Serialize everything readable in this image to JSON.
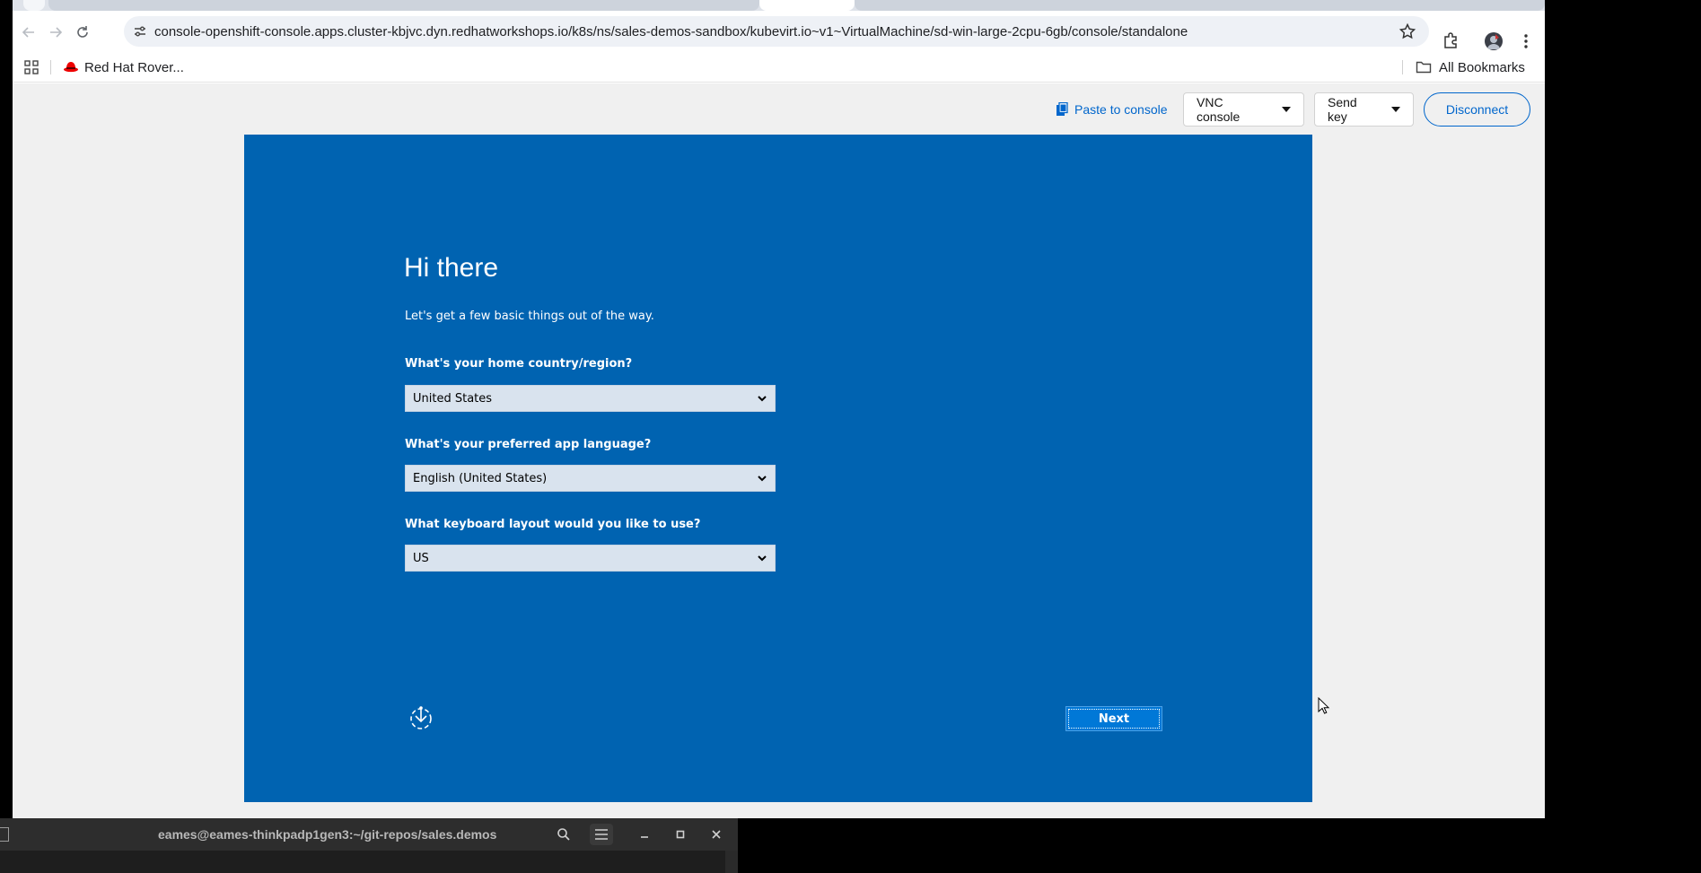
{
  "browser": {
    "url": "console-openshift-console.apps.cluster-kbjvc.dyn.redhatworkshops.io/k8s/ns/sales-demos-sandbox/kubevirt.io~v1~VirtualMachine/sd-win-large-2cpu-6gb/console/standalone",
    "icons": [
      "back-icon",
      "forward-icon",
      "reload-icon",
      "site-info-icon",
      "star-icon",
      "extensions-icon",
      "profile-avatar",
      "menu-icon"
    ]
  },
  "bookmarks": {
    "items": [
      {
        "label": "Red Hat Rover..."
      }
    ],
    "all_bookmarks_label": "All Bookmarks"
  },
  "console_toolbar": {
    "paste_label": "Paste to console",
    "vnc_label": "VNC console",
    "send_key_label": "Send key",
    "disconnect_label": "Disconnect",
    "accent_color": "#0066cc"
  },
  "vm_screen": {
    "title": "Hi there",
    "subtitle": "Let's get a few basic things out of the way.",
    "fields": [
      {
        "label": "What's your home country/region?",
        "value": "United States"
      },
      {
        "label": "What's your preferred app language?",
        "value": "English (United States)"
      },
      {
        "label": "What keyboard layout would you like to use?",
        "value": "US"
      }
    ],
    "next_label": "Next",
    "background_color": "#0063b1"
  },
  "terminal": {
    "title": "eames@eames-thinkpadp1gen3:~/git-repos/sales.demos"
  }
}
